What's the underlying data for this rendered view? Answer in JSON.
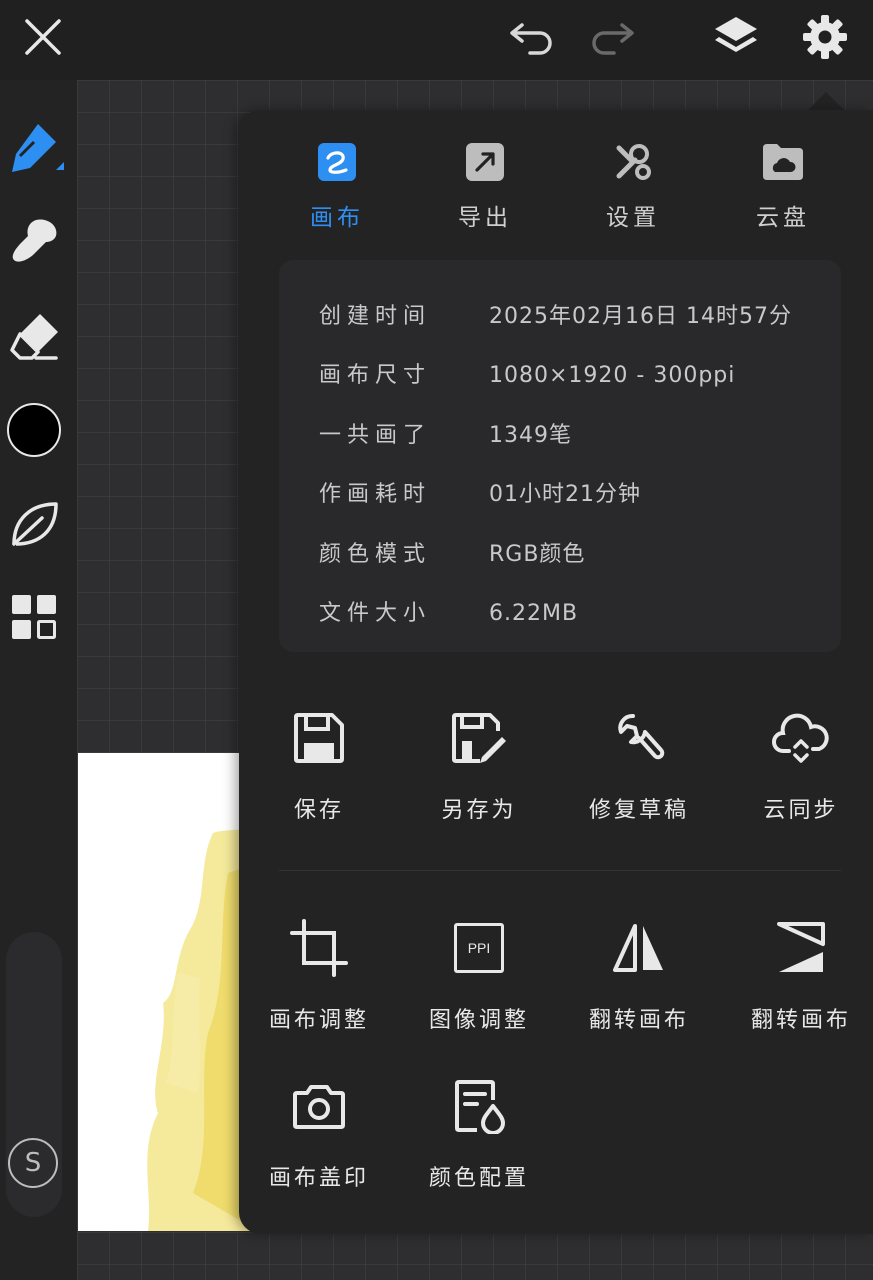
{
  "topbar": {
    "close_icon": "close-icon",
    "undo_icon": "undo-icon",
    "redo_icon": "redo-icon",
    "layers_icon": "layers-icon",
    "settings_icon": "gear-icon"
  },
  "toolbar": {
    "tools": [
      "pen-icon",
      "smudge-icon",
      "eraser-icon",
      "color-swatch",
      "leaf-icon",
      "grid-apps-icon"
    ],
    "accent": "#2e8ff3",
    "current_color": "#000000",
    "size_label": "S"
  },
  "panel": {
    "tabs": [
      {
        "label": "画布",
        "icon": "canvas-icon",
        "active": true
      },
      {
        "label": "导出",
        "icon": "export-icon",
        "active": false
      },
      {
        "label": "设置",
        "icon": "tools-icon",
        "active": false
      },
      {
        "label": "云盘",
        "icon": "cloud-drive-icon",
        "active": false
      }
    ],
    "info": [
      {
        "key": "创建时间",
        "value": "2025年02月16日 14时57分"
      },
      {
        "key": "画布尺寸",
        "value": "1080×1920 - 300ppi"
      },
      {
        "key": "一共画了",
        "value": "1349笔"
      },
      {
        "key": "作画耗时",
        "value": "01小时21分钟"
      },
      {
        "key": "颜色模式",
        "value": "RGB颜色"
      },
      {
        "key": "文件大小",
        "value": "6.22MB"
      }
    ],
    "actions_row1": [
      {
        "label": "保存",
        "icon": "save-icon"
      },
      {
        "label": "另存为",
        "icon": "save-as-icon"
      },
      {
        "label": "修复草稿",
        "icon": "wrench-icon"
      },
      {
        "label": "云同步",
        "icon": "cloud-sync-icon"
      }
    ],
    "actions_row2": [
      {
        "label": "画布调整",
        "icon": "crop-icon"
      },
      {
        "label": "图像调整",
        "icon": "ppi-icon",
        "icon_text": "PPI"
      },
      {
        "label": "翻转画布",
        "icon": "flip-horizontal-icon"
      },
      {
        "label": "翻转画布",
        "icon": "flip-vertical-icon"
      }
    ],
    "actions_row3": [
      {
        "label": "画布盖印",
        "icon": "camera-icon"
      },
      {
        "label": "颜色配置",
        "icon": "color-config-icon"
      }
    ]
  }
}
